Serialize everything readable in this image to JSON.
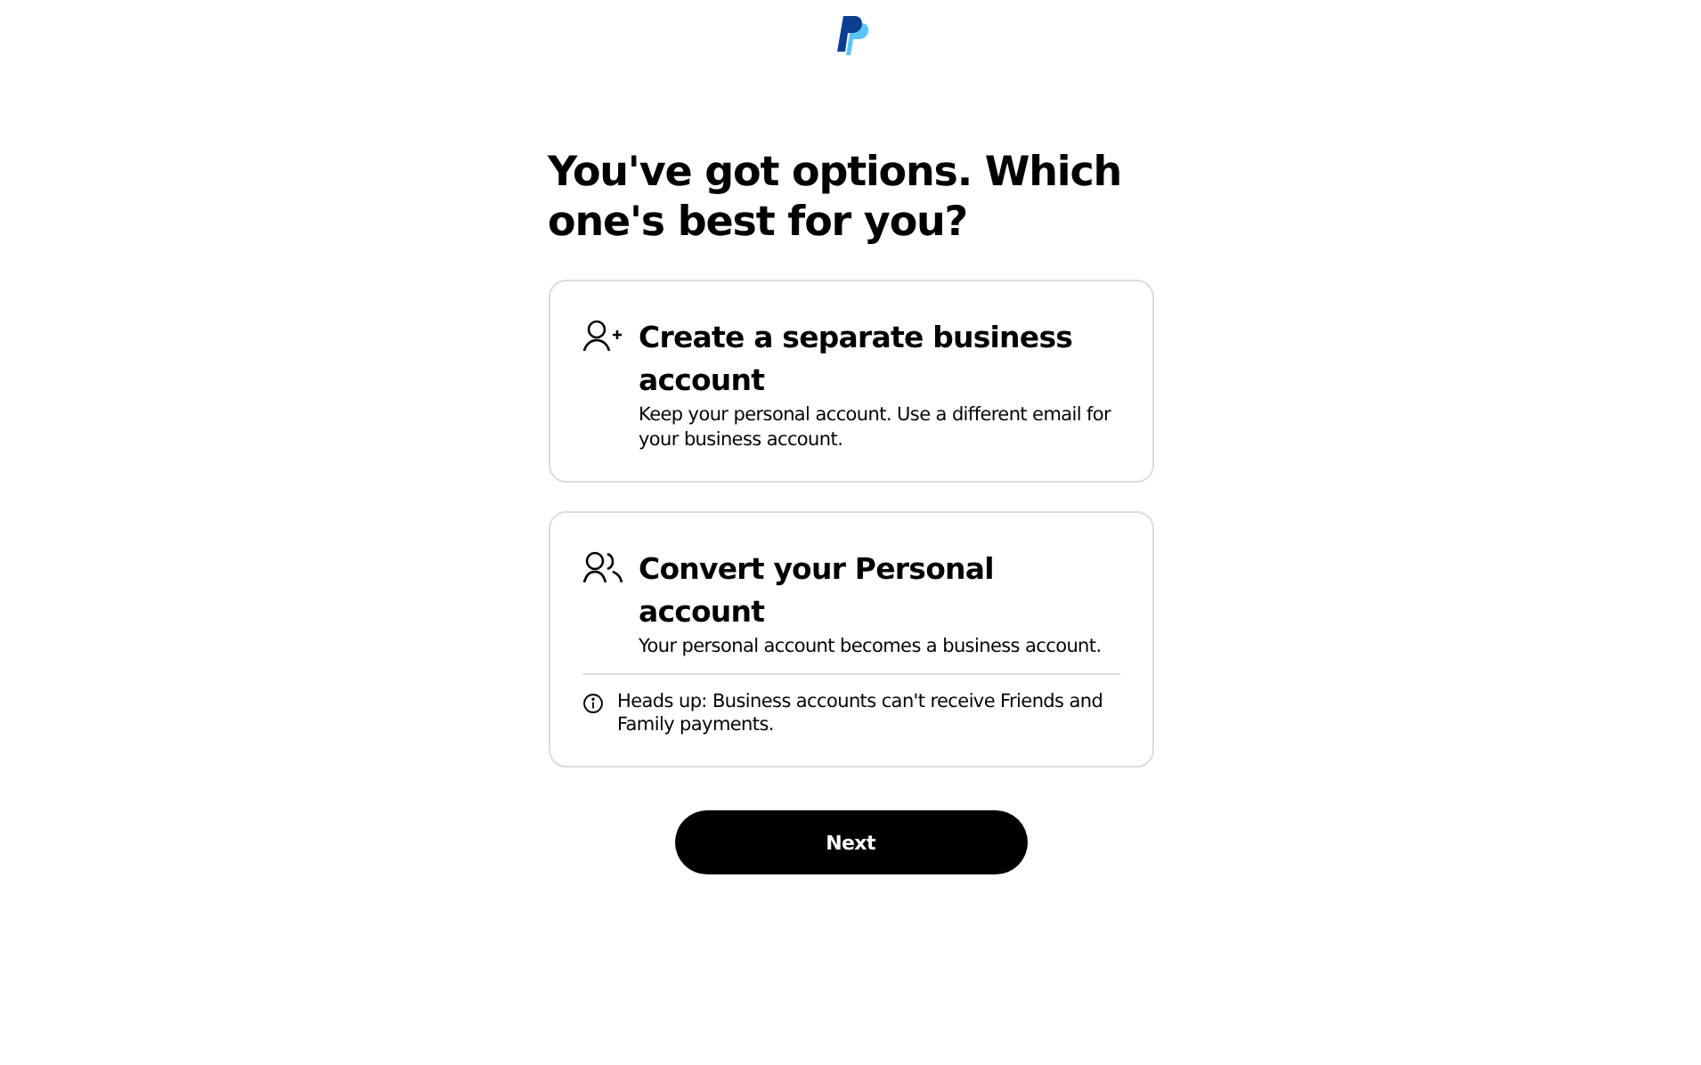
{
  "heading": "You've got options. Which one's best for you?",
  "options": [
    {
      "kind": "add-person",
      "title": "Create a separate business account",
      "description": "Keep your personal account. Use a different email for your business account."
    },
    {
      "kind": "people",
      "title": "Convert your Personal account",
      "description": "Your personal account becomes a business account.",
      "note": "Heads up: Business accounts can't receive Friends and Family payments."
    }
  ],
  "button": "Next"
}
